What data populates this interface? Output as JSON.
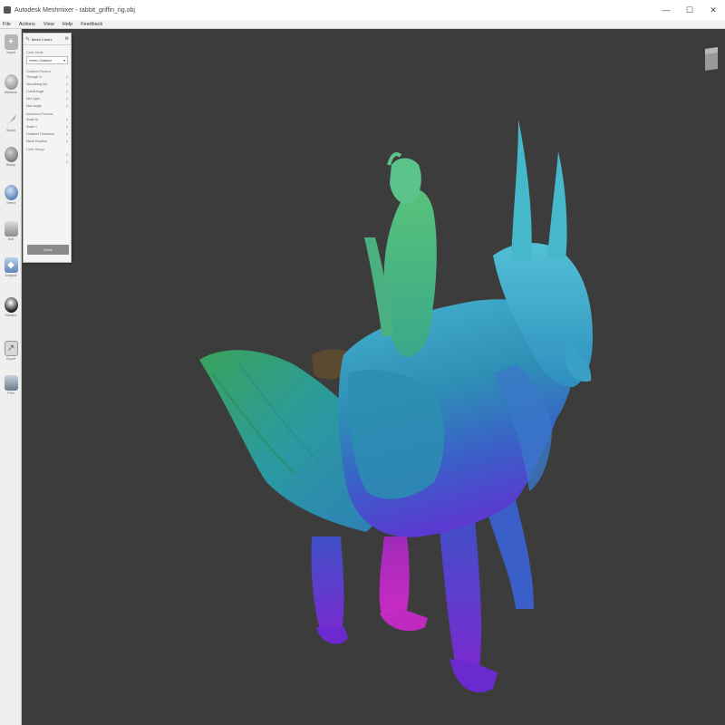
{
  "window": {
    "title": "Autodesk Meshmixer - rabbit_griffin_rig.obj",
    "minimize_glyph": "—",
    "maximize_glyph": "☐",
    "close_glyph": "✕"
  },
  "menubar": {
    "items": [
      "File",
      "Actions",
      "View",
      "Help",
      "Feedback"
    ]
  },
  "shelf": {
    "tools": [
      {
        "icon": "plus-icon",
        "label": "Import",
        "color": "#9a9a9a"
      },
      {
        "icon": "meshmix-icon",
        "label": "Meshmix",
        "color": "#8a8a8a"
      },
      {
        "icon": "sculpt-icon",
        "label": "Sculpt",
        "color": "#a6a6a6"
      },
      {
        "icon": "stamp-icon",
        "label": "Stamp",
        "color": "#7d7d7d"
      },
      {
        "icon": "select-icon",
        "label": "Select",
        "color": "#3d6aa5"
      },
      {
        "icon": "edit-icon",
        "label": "Edit",
        "color": "#9a9a9a"
      },
      {
        "icon": "analysis-icon",
        "label": "Analysis",
        "color": "#5f86b8"
      },
      {
        "icon": "shaders-icon",
        "label": "Shaders",
        "color": "#333333"
      },
      {
        "icon": "export-icon",
        "label": "Export",
        "color": "#9a9a9a"
      },
      {
        "icon": "print-icon",
        "label": "Print",
        "color": "#7a8a9a"
      }
    ]
  },
  "panel": {
    "title": "Mesh Colors",
    "section1": "Color Mode",
    "dropdown_value": "Vertex Gradient",
    "section2": "Gradient Params",
    "rows1": [
      {
        "label": "Through X",
        "value": "0"
      },
      {
        "label": "Smoothing Iter",
        "value": "0"
      },
      {
        "label": "Cutoff Angle",
        "value": "0"
      },
      {
        "label": "Min Light",
        "value": "0"
      },
      {
        "label": "Max Angle",
        "value": "0"
      }
    ],
    "section3": "Advanced Params",
    "rows2": [
      {
        "label": "Scale M",
        "value": "0"
      },
      {
        "label": "Scale Y",
        "value": "0"
      },
      {
        "label": "Gradient Thickness",
        "value": "0"
      },
      {
        "label": "Mesh Position",
        "value": "0"
      }
    ],
    "section4": "Color Range",
    "rows3": [
      {
        "label": "",
        "value": "0"
      },
      {
        "label": "",
        "value": "0"
      }
    ],
    "button": "Done"
  },
  "viewport": {
    "background": "#3c3c3c",
    "model_description_colors": {
      "green": "#3aa35a",
      "teal": "#2a9aa0",
      "cyan": "#46b3d0",
      "blue": "#3a5fc8",
      "purple": "#7030c8",
      "magenta": "#c02ac0"
    }
  }
}
